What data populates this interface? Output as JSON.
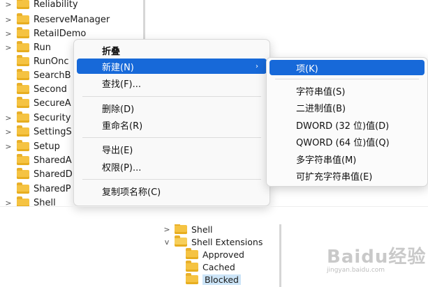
{
  "top_tree": {
    "items": [
      {
        "label": "Reliability",
        "expandable": true
      },
      {
        "label": "ReserveManager",
        "expandable": true
      },
      {
        "label": "RetailDemo",
        "expandable": true
      },
      {
        "label": "Run",
        "expandable": true
      },
      {
        "label": "RunOnc",
        "expandable": false
      },
      {
        "label": "SearchB",
        "expandable": false
      },
      {
        "label": "Second",
        "expandable": false
      },
      {
        "label": "SecureA",
        "expandable": false
      },
      {
        "label": "Security",
        "expandable": true
      },
      {
        "label": "SettingS",
        "expandable": true
      },
      {
        "label": "Setup",
        "expandable": true
      },
      {
        "label": "SharedA",
        "expandable": false
      },
      {
        "label": "SharedD",
        "expandable": false
      },
      {
        "label": "SharedP",
        "expandable": false
      },
      {
        "label": "Shell",
        "expandable": true
      }
    ]
  },
  "context_menu": {
    "collapse": "折叠",
    "new": "新建(N)",
    "find": "查找(F)...",
    "delete": "删除(D)",
    "rename": "重命名(R)",
    "export": "导出(E)",
    "permissions": "权限(P)...",
    "copy_key_name": "复制项名称(C)",
    "submenu_arrow": "›"
  },
  "submenu": {
    "key": "项(K)",
    "string_value": "字符串值(S)",
    "binary_value": "二进制值(B)",
    "dword_value": "DWORD (32 位)值(D)",
    "qword_value": "QWORD (64 位)值(Q)",
    "multi_string_value": "多字符串值(M)",
    "expandable_string_value": "可扩充字符串值(E)"
  },
  "bottom_tree": {
    "items": [
      {
        "label": "Shell",
        "level": 0,
        "chevron": ">"
      },
      {
        "label": "Shell Extensions",
        "level": 0,
        "chevron": "v"
      },
      {
        "label": "Approved",
        "level": 1,
        "chevron": ""
      },
      {
        "label": "Cached",
        "level": 1,
        "chevron": ""
      },
      {
        "label": "Blocked",
        "level": 1,
        "chevron": "",
        "selected": true
      }
    ]
  },
  "watermark": {
    "main": "Baidu经验",
    "sub": "jingyan.baidu.com"
  },
  "colors": {
    "highlight": "#1769d9",
    "folder": "#f5c342",
    "selection": "#cce4f7"
  }
}
